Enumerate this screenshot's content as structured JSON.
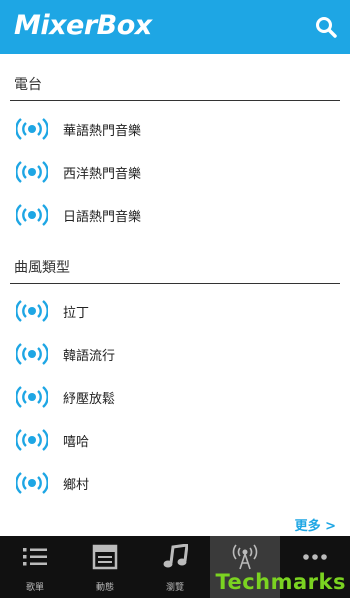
{
  "app": {
    "logo_text": "MixerBox"
  },
  "header": {
    "search_icon": "search-icon"
  },
  "sections": [
    {
      "title": "電台",
      "items": [
        "華語熱門音樂",
        "西洋熱門音樂",
        "日語熱門音樂"
      ]
    },
    {
      "title": "曲風類型",
      "items": [
        "拉丁",
        "韓語流行",
        "紓壓放鬆",
        "嘻哈",
        "鄉村"
      ]
    }
  ],
  "more_label": "更多 >",
  "tabs": [
    {
      "label": "歌單",
      "icon": "list-icon"
    },
    {
      "label": "動態",
      "icon": "feed-icon"
    },
    {
      "label": "瀏覽",
      "icon": "music-note-icon"
    },
    {
      "label": "",
      "icon": "antenna-icon",
      "active": true
    },
    {
      "label": "",
      "icon": "more-dots-icon"
    }
  ],
  "watermark": "Techmarks",
  "colors": {
    "accent": "#1ea6e4",
    "tabbar": "#111111",
    "watermark": "#7bd321"
  }
}
